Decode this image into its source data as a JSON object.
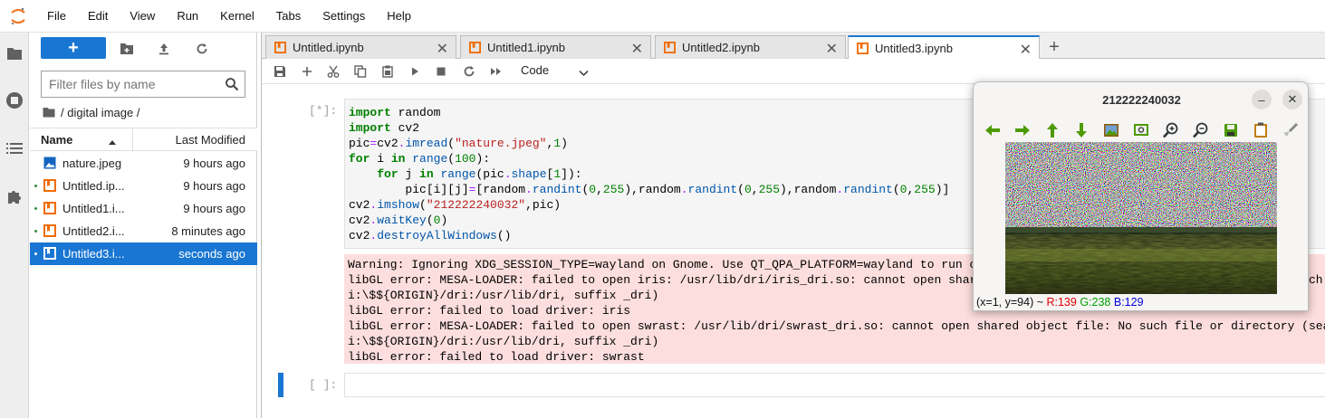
{
  "menubar": {
    "items": [
      "File",
      "Edit",
      "View",
      "Run",
      "Kernel",
      "Tabs",
      "Settings",
      "Help"
    ]
  },
  "activity_icons": [
    "folder-icon",
    "running-icon",
    "toc-icon",
    "extension-icon"
  ],
  "filebrowser": {
    "new_label": "+",
    "filter_placeholder": "Filter files by name",
    "breadcrumb": "/ digital image /",
    "col_name": "Name",
    "col_modified": "Last Modified",
    "files": [
      {
        "name": "nature.jpeg",
        "modified": "9 hours ago",
        "type": "image",
        "running": false,
        "selected": false
      },
      {
        "name": "Untitled.ip...",
        "modified": "9 hours ago",
        "type": "notebook",
        "running": true,
        "selected": false
      },
      {
        "name": "Untitled1.i...",
        "modified": "9 hours ago",
        "type": "notebook",
        "running": true,
        "selected": false
      },
      {
        "name": "Untitled2.i...",
        "modified": "8 minutes ago",
        "type": "notebook",
        "running": true,
        "selected": false
      },
      {
        "name": "Untitled3.i...",
        "modified": "seconds ago",
        "type": "notebook",
        "running": true,
        "selected": true
      }
    ]
  },
  "tabs": [
    {
      "label": "Untitled.ipynb",
      "active": false
    },
    {
      "label": "Untitled1.ipynb",
      "active": false
    },
    {
      "label": "Untitled2.ipynb",
      "active": false
    },
    {
      "label": "Untitled3.ipynb",
      "active": true
    }
  ],
  "notebook": {
    "cell_type": "Code",
    "cells": [
      {
        "prompt": "[*]:"
      },
      {
        "prompt": "[ ]:"
      }
    ],
    "output_lines": [
      "Warning: Ignoring XDG_SESSION_TYPE=wayland on Gnome. Use QT_QPA_PLATFORM=wayland to run on Wayland anyway.",
      "libGL error: MESA-LOADER: failed to open iris: /usr/lib/dri/iris_dri.so: cannot open shared object file: No such file or directory (search paths /usr/lib/x86_64-linux-gnu/dri:\\$${ORIGIN}/dri:/usr/lib/dri, suffix _dri)",
      "i:\\$${ORIGIN}/dri:/usr/lib/dri, suffix _dri)",
      "libGL error: failed to load driver: iris",
      "libGL error: MESA-LOADER: failed to open swrast: /usr/lib/dri/swrast_dri.so: cannot open shared object file: No such file or directory (search paths /usr/lib/x86_64-linux-gnu/dri:\\$${ORIGIN}/dri:/usr/lib/dri, suffix _dri)",
      "i:\\$${ORIGIN}/dri:/usr/lib/dri, suffix _dri)",
      "libGL error: failed to load driver: swrast"
    ]
  },
  "cv_window": {
    "title": "212222240032",
    "status_prefix": "(x=1, y=94) ~ ",
    "r": "R:139",
    "g": "G:238",
    "b": "B:129",
    "colors": {
      "r": "#e00000",
      "g": "#00a000",
      "b": "#0000dd"
    }
  }
}
